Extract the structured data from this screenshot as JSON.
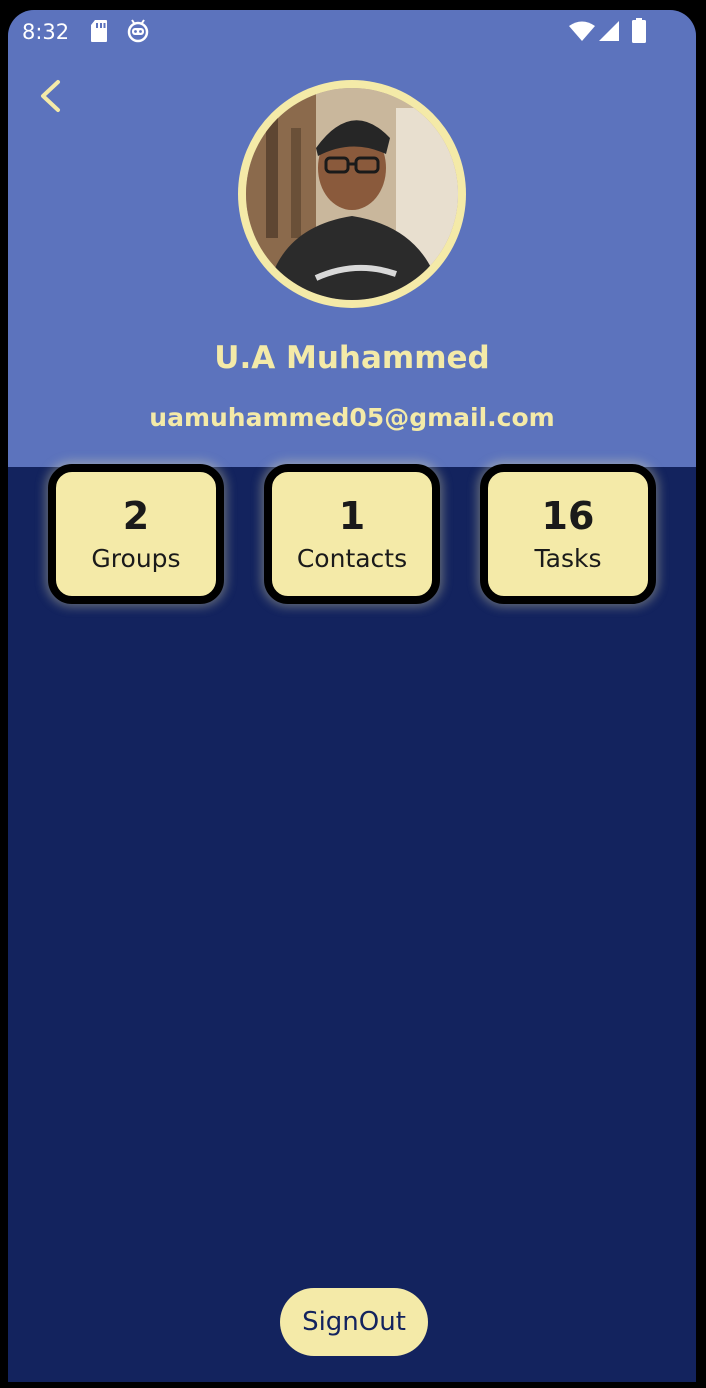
{
  "status_bar": {
    "time": "8:32",
    "icons": [
      "sd-card-icon",
      "robot-icon",
      "wifi-icon",
      "signal-icon",
      "battery-icon"
    ]
  },
  "header": {
    "back_icon": "chevron-left-icon"
  },
  "profile": {
    "name": "U.A Muhammed",
    "email": "uamuhammed05@gmail.com"
  },
  "stats": [
    {
      "value": "2",
      "label": "Groups"
    },
    {
      "value": "1",
      "label": "Contacts"
    },
    {
      "value": "16",
      "label": "Tasks"
    }
  ],
  "actions": {
    "signout_label": "SignOut"
  },
  "colors": {
    "header_bg": "#5c73bd",
    "body_bg": "#13235e",
    "accent": "#f4eaa8",
    "card_border": "#000000"
  }
}
